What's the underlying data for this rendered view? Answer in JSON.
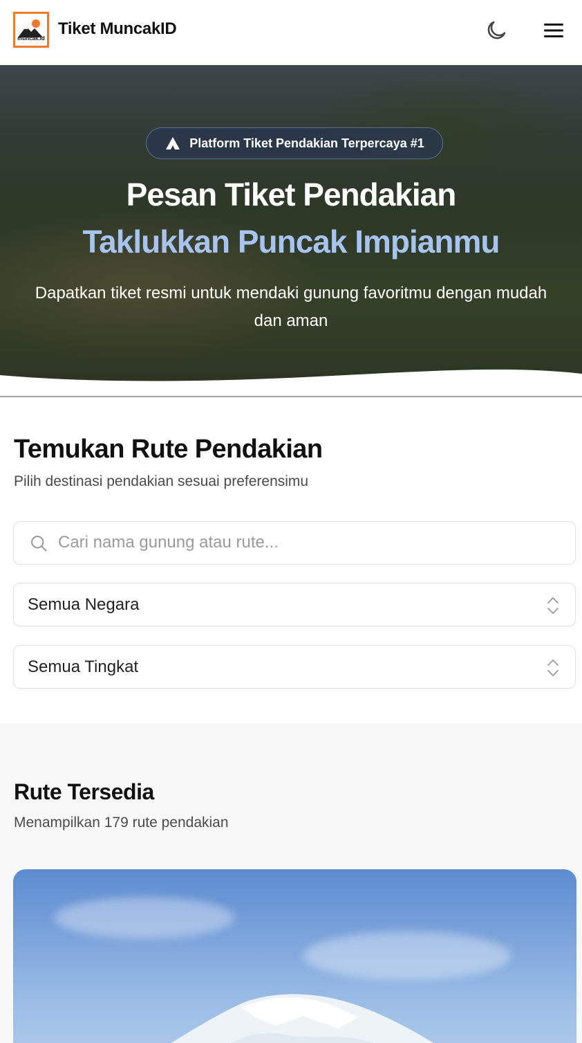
{
  "header": {
    "logo_text": "muncak.id",
    "brand": "Tiket MuncakID",
    "theme_icon": "moon-icon",
    "menu_icon": "hamburger-menu-icon"
  },
  "hero": {
    "badge": "Platform Tiket Pendakian Terpercaya #1",
    "badge_icon": "mountain-peak-icon",
    "title_line1": "Pesan Tiket Pendakian",
    "title_line2": "Taklukkan Puncak Impianmu",
    "subtitle": "Dapatkan tiket resmi untuk mendaki gunung favoritmu dengan mudah dan aman"
  },
  "search_section": {
    "title": "Temukan Rute Pendakian",
    "subtitle": "Pilih destinasi pendakian sesuai preferensimu",
    "search_placeholder": "Cari nama gunung atau rute...",
    "country_select": "Semua Negara",
    "level_select": "Semua Tingkat"
  },
  "routes_section": {
    "title": "Rute Tersedia",
    "subtitle": "Menampilkan 179 rute pendakian"
  },
  "colors": {
    "accent": "#f07a2a",
    "hero_highlight": "#a7c4f0",
    "badge_bg": "#28374f"
  }
}
